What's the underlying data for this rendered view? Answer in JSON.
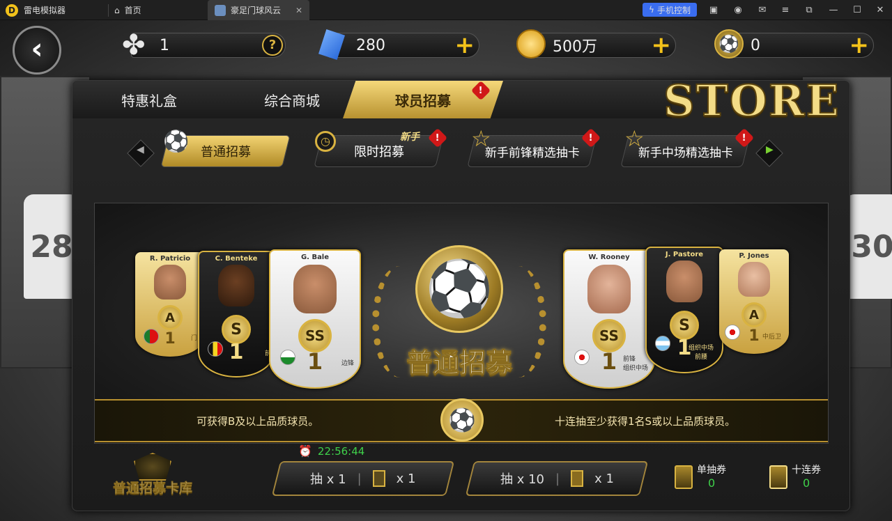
{
  "window": {
    "app_name": "雷电模拟器",
    "tabs": [
      {
        "label": "首页"
      },
      {
        "label": "豪足门球风云"
      }
    ],
    "phone_control": "手机控制"
  },
  "currencies": {
    "clover": "1",
    "help": "?",
    "gems": "280",
    "coins": "500万",
    "ball": "0"
  },
  "store_title": "STORE",
  "main_tabs": [
    "特惠礼盒",
    "综合商城",
    "球员招募"
  ],
  "sub_tabs": [
    {
      "label": "普通招募",
      "tag": ""
    },
    {
      "label": "限时招募",
      "tag": "新手"
    },
    {
      "label": "新手前锋精选抽卡",
      "tag": ""
    },
    {
      "label": "新手中场精选抽卡",
      "tag": ""
    }
  ],
  "badge_text": "!",
  "cards": [
    {
      "name": "R. Patricio",
      "grade": "A",
      "num": "1",
      "pos": "门"
    },
    {
      "name": "C. Benteke",
      "grade": "S",
      "num": "1",
      "pos": "前"
    },
    {
      "name": "G. Bale",
      "grade": "SS",
      "num": "1",
      "pos": "边锋"
    },
    {
      "name": "W. Rooney",
      "grade": "SS",
      "num": "1",
      "pos": "前锋\n组织中场"
    },
    {
      "name": "J. Pastore",
      "grade": "S",
      "num": "1",
      "pos": "组织中场\n前腰"
    },
    {
      "name": "P. Jones",
      "grade": "A",
      "num": "1",
      "pos": "中后卫"
    }
  ],
  "emblem_title": "普通招募",
  "info_left": "可获得B及以上品质球员。",
  "info_right": "十连抽至少获得1名S或以上品质球员。",
  "timer": "22:56:44",
  "library_label": "普通招募卡库",
  "buttons": [
    {
      "label": "抽 x 1",
      "cost": "x 1"
    },
    {
      "label": "抽 x 10",
      "cost": "x 1"
    }
  ],
  "tickets": [
    {
      "label": "单抽券",
      "count": "0"
    },
    {
      "label": "十连券",
      "count": "0"
    }
  ],
  "colors": {
    "gold": "#d9b341",
    "count_green": "#3fd14a",
    "badge_red": "#d01818"
  }
}
